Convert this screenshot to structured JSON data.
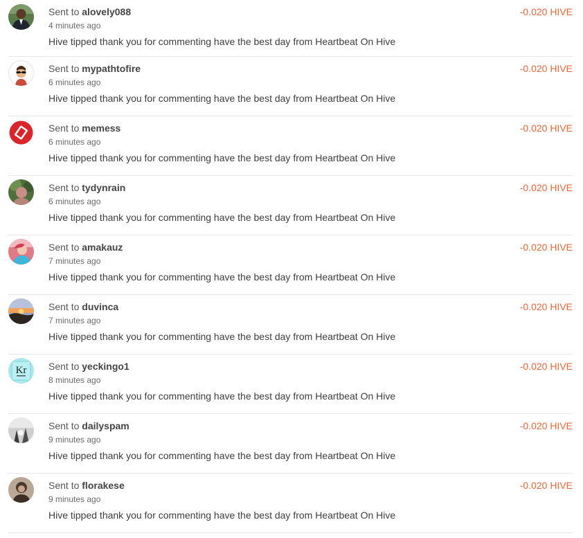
{
  "transfers": [
    {
      "prefix": "Sent to",
      "user": "alovely088",
      "time": "4 minutes ago",
      "memo": "Hive tipped thank you for commenting have the best day from Heartbeat On Hive",
      "amount": "-0.020 HIVE",
      "avatar": "person-suit-photo"
    },
    {
      "prefix": "Sent to",
      "user": "mypathtofire",
      "time": "6 minutes ago",
      "memo": "Hive tipped thank you for commenting have the best day from Heartbeat On Hive",
      "amount": "-0.020 HIVE",
      "avatar": "cartoon-face-sunglasses"
    },
    {
      "prefix": "Sent to",
      "user": "memess",
      "time": "6 minutes ago",
      "memo": "Hive tipped thank you for commenting have the best day from Heartbeat On Hive",
      "amount": "-0.020 HIVE",
      "avatar": "red-logo"
    },
    {
      "prefix": "Sent to",
      "user": "tydynrain",
      "time": "6 minutes ago",
      "memo": "Hive tipped thank you for commenting have the best day from Heartbeat On Hive",
      "amount": "-0.020 HIVE",
      "avatar": "outdoor-portrait-photo"
    },
    {
      "prefix": "Sent to",
      "user": "amakauz",
      "time": "7 minutes ago",
      "memo": "Hive tipped thank you for commenting have the best day from Heartbeat On Hive",
      "amount": "-0.020 HIVE",
      "avatar": "pink-portrait-photo"
    },
    {
      "prefix": "Sent to",
      "user": "duvinca",
      "time": "7 minutes ago",
      "memo": "Hive tipped thank you for commenting have the best day from Heartbeat On Hive",
      "amount": "-0.020 HIVE",
      "avatar": "sunset-landscape-photo"
    },
    {
      "prefix": "Sent to",
      "user": "yeckingo1",
      "time": "8 minutes ago",
      "memo": "Hive tipped thank you for commenting have the best day from Heartbeat On Hive",
      "amount": "-0.020 HIVE",
      "avatar": "kr-element-logo",
      "avatar_text": "Kr"
    },
    {
      "prefix": "Sent to",
      "user": "dailyspam",
      "time": "9 minutes ago",
      "memo": "Hive tipped thank you for commenting have the best day from Heartbeat On Hive",
      "amount": "-0.020 HIVE",
      "avatar": "bw-photo"
    },
    {
      "prefix": "Sent to",
      "user": "florakese",
      "time": "9 minutes ago",
      "memo": "Hive tipped thank you for commenting have the best day from Heartbeat On Hive",
      "amount": "-0.020 HIVE",
      "avatar": "portrait-photo"
    }
  ],
  "colors": {
    "amount": "#e8683a",
    "divider": "#e6e6e6",
    "text": "#3d3d3d",
    "muted": "#6a6a6a"
  }
}
